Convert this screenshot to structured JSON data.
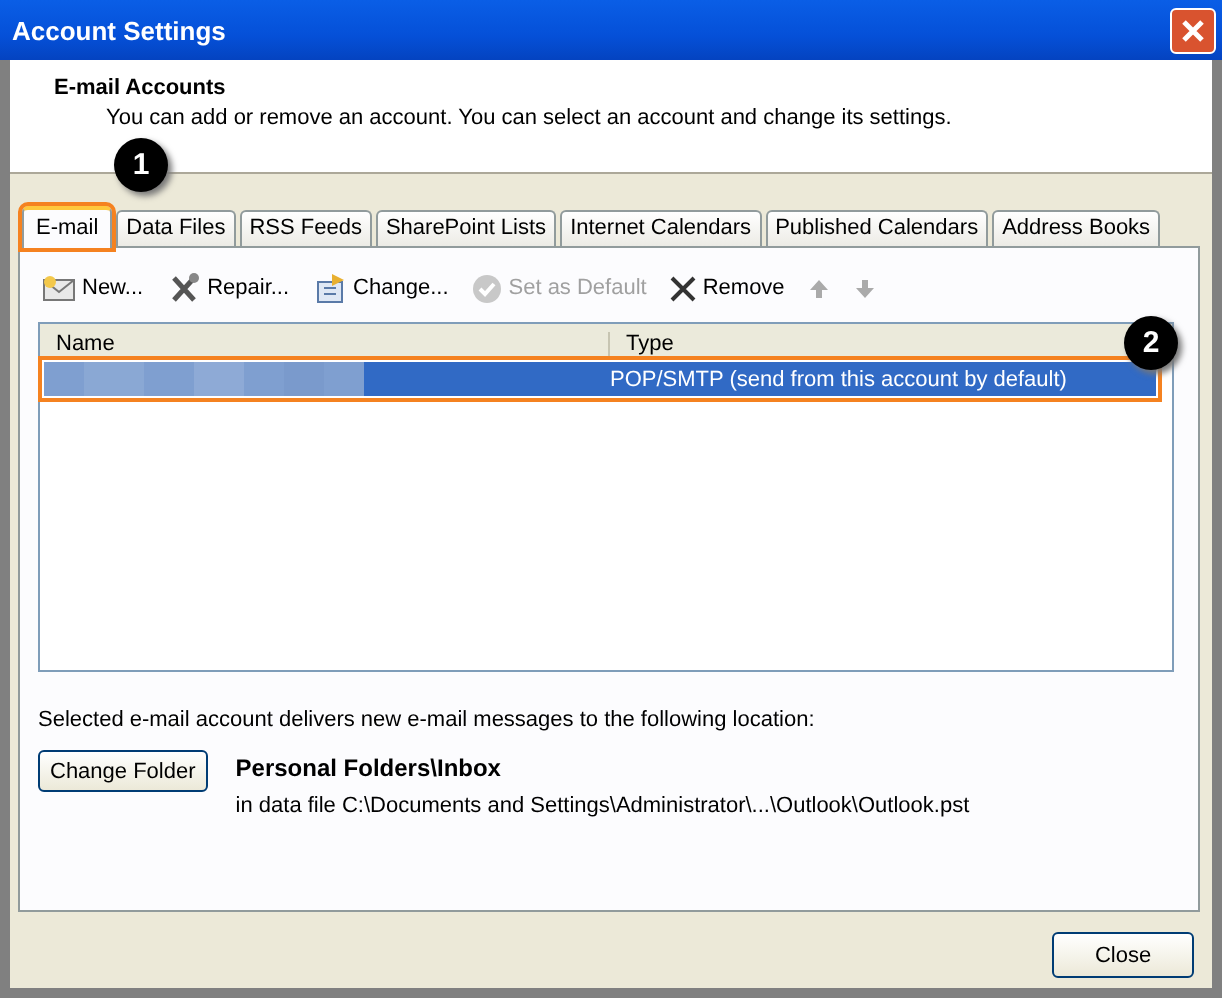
{
  "window": {
    "title": "Account Settings"
  },
  "header": {
    "title": "E-mail Accounts",
    "description": "You can add or remove an account. You can select an account and change its settings."
  },
  "tabs": [
    {
      "label": "E-mail",
      "selected": true,
      "callout": "1"
    },
    {
      "label": "Data Files",
      "selected": false
    },
    {
      "label": "RSS Feeds",
      "selected": false
    },
    {
      "label": "SharePoint Lists",
      "selected": false
    },
    {
      "label": "Internet Calendars",
      "selected": false
    },
    {
      "label": "Published Calendars",
      "selected": false
    },
    {
      "label": "Address Books",
      "selected": false
    }
  ],
  "toolbar": [
    {
      "kind": "new",
      "label": "New...",
      "disabled": false
    },
    {
      "kind": "repair",
      "label": "Repair...",
      "disabled": false
    },
    {
      "kind": "change",
      "label": "Change...",
      "disabled": false
    },
    {
      "kind": "default",
      "label": "Set as Default",
      "disabled": true
    },
    {
      "kind": "remove",
      "label": "Remove",
      "disabled": false
    },
    {
      "kind": "up",
      "disabled": true
    },
    {
      "kind": "down",
      "disabled": true
    }
  ],
  "table": {
    "columns": [
      "Name",
      "Type"
    ],
    "rows": [
      {
        "name_redacted": true,
        "type": "POP/SMTP (send from this account by default)",
        "selected": true,
        "callout": "2"
      }
    ]
  },
  "location": {
    "message": "Selected e-mail account delivers new e-mail messages to the following location:",
    "button": "Change Folder",
    "folder": "Personal Folders\\Inbox",
    "path": "in data file C:\\Documents and Settings\\Administrator\\...\\Outlook\\Outlook.pst"
  },
  "buttons": [
    "Close"
  ]
}
